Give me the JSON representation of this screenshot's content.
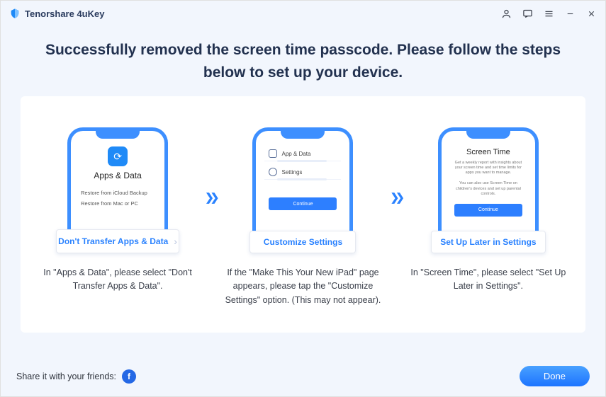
{
  "app": {
    "title": "Tenorshare 4uKey"
  },
  "heading": "Successfully removed the screen time passcode. Please follow the steps below to set up your device.",
  "steps": {
    "step1": {
      "phone_title": "Apps & Data",
      "option1": "Restore from iCloud Backup",
      "option2": "Restore from Mac or PC",
      "callout": "Don't Transfer Apps & Data",
      "desc": "In \"Apps & Data\", please select \"Don't Transfer Apps & Data\"."
    },
    "step2": {
      "row1": "App & Data",
      "row2": "Settings",
      "continue": "Continue",
      "callout": "Customize Settings",
      "desc": "If the \"Make This Your New iPad\" page appears, please tap the \"Customize Settings\" option. (This may not appear)."
    },
    "step3": {
      "phone_title": "Screen Time",
      "sub1": "Get a weekly report with insights about your screen time and set time limits for apps you want to manage.",
      "sub2": "You can also use Screen Time on children's devices and set up parental controls.",
      "continue": "Continue",
      "callout": "Set Up Later in Settings",
      "desc": "In \"Screen Time\", please select \"Set Up Later in Settings\"."
    }
  },
  "arrow_glyph": "❯❯",
  "footer": {
    "share": "Share it with your friends:",
    "fb": "f",
    "done": "Done"
  }
}
